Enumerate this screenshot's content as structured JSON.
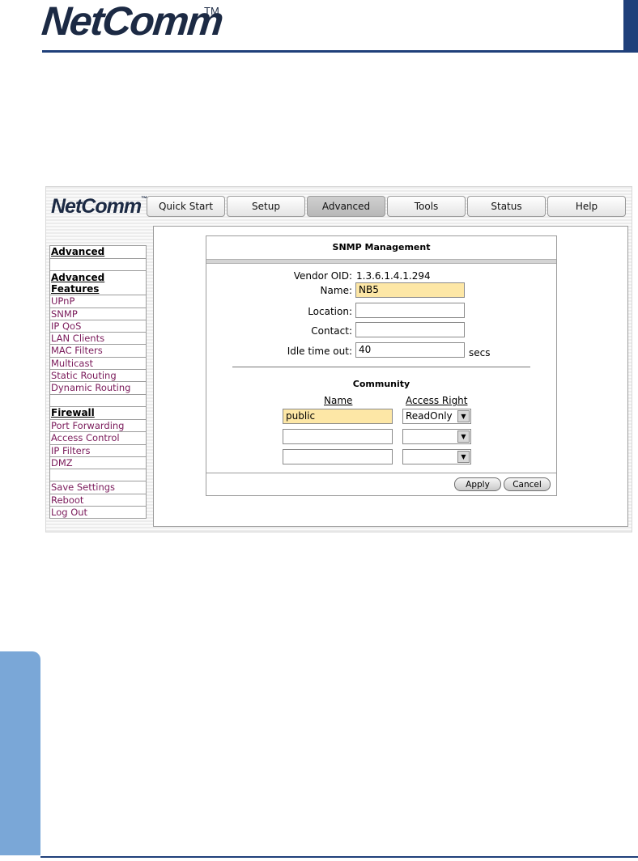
{
  "brand": {
    "logo_text": "NetComm",
    "tm": "TM",
    "small_tm": "™"
  },
  "tabs": [
    {
      "label": "Quick Start",
      "active": false
    },
    {
      "label": "Setup",
      "active": false
    },
    {
      "label": "Advanced",
      "active": true
    },
    {
      "label": "Tools",
      "active": false
    },
    {
      "label": "Status",
      "active": false
    },
    {
      "label": "Help",
      "active": false
    }
  ],
  "sidebar": {
    "section_advanced": "Advanced",
    "section_features": "Advanced Features",
    "features": [
      "UPnP",
      "SNMP",
      "IP QoS",
      "LAN Clients",
      "MAC Filters",
      "Multicast",
      "Static Routing",
      "Dynamic Routing"
    ],
    "section_firewall": "Firewall",
    "firewall": [
      "Port Forwarding",
      "Access Control",
      "IP Filters",
      "DMZ"
    ],
    "system": [
      "Save Settings",
      "Reboot",
      "Log Out"
    ]
  },
  "snmp": {
    "title": "SNMP Management",
    "vendor_label": "Vendor OID:",
    "vendor_value": "1.3.6.1.4.1.294",
    "name_label": "Name:",
    "name_value": "NB5",
    "location_label": "Location:",
    "location_value": "",
    "contact_label": "Contact:",
    "contact_value": "",
    "idle_label": "Idle time out:",
    "idle_value": "40",
    "idle_unit": "secs"
  },
  "community": {
    "title": "Community",
    "col_name": "Name",
    "col_access": "Access Right",
    "rows": [
      {
        "name": "public",
        "access": "ReadOnly"
      },
      {
        "name": "",
        "access": ""
      },
      {
        "name": "",
        "access": ""
      }
    ]
  },
  "buttons": {
    "apply": "Apply",
    "cancel": "Cancel"
  },
  "colors": {
    "link": "#7a1a5a",
    "highlight": "#fde7a6",
    "brand_blue": "#1f3f7a",
    "side_tab": "#7aa7d7"
  }
}
